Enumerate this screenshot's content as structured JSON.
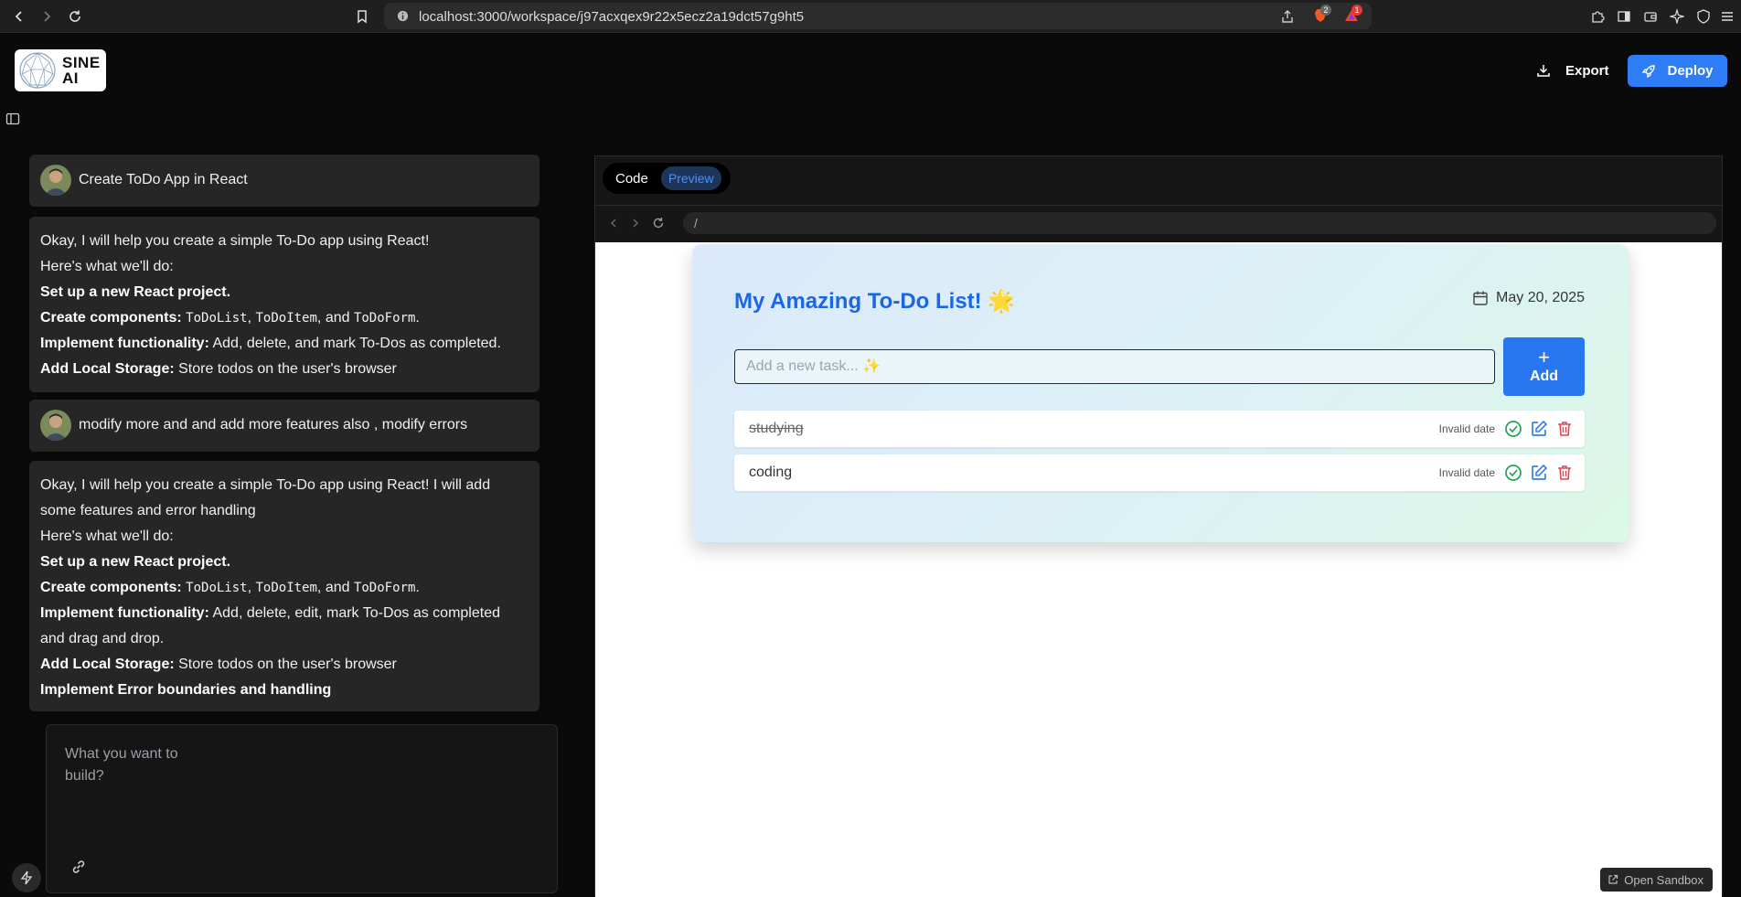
{
  "browser": {
    "url": "localhost:3000/workspace/j97acxqex9r22x5ecz2a19dct57g9ht5",
    "brave_badge": "2",
    "alert_badge": "1"
  },
  "header": {
    "logo_text": "SINE\nAI",
    "export_label": "Export",
    "deploy_label": "Deploy"
  },
  "chat": {
    "user_msg_1": "Create ToDo App in React",
    "ai_msg_1": {
      "line1": "Okay, I will help you create a simple To-Do app using React!",
      "line2": "Here's what we'll do:",
      "step1": "Set up a new React project.",
      "step2_label": "Create components:",
      "comp1": "ToDoList",
      "comp2": "ToDoItem",
      "comp3": "ToDoForm",
      "sep1": ", ",
      "sep2": ", and ",
      "end": ".",
      "step3_label": "Implement functionality:",
      "step3_text": " Add, delete, and mark To-Dos as completed.",
      "step4_label": "Add Local Storage:",
      "step4_text": " Store todos on the user's browser"
    },
    "user_msg_2": "modify more and and add more features also , modify errors",
    "ai_msg_2": {
      "line1": "Okay, I will help you create a simple To-Do app using React! I will add some features and error handling",
      "line2": "Here's what we'll do:",
      "step1": "Set up a new React project.",
      "step2_label": "Create components:",
      "comp1": "ToDoList",
      "comp2": "ToDoItem",
      "comp3": "ToDoForm",
      "sep1": ", ",
      "sep2": ", and ",
      "end": ".",
      "step3_label": "Implement functionality:",
      "step3_text": " Add, delete, edit, mark To-Dos as completed and drag and drop.",
      "step4_label": "Add Local Storage:",
      "step4_text": " Store todos on the user's browser",
      "step5": "Implement Error boundaries and handling"
    },
    "prompt_placeholder": "What you want to build?"
  },
  "preview": {
    "tab_code": "Code",
    "tab_preview": "Preview",
    "path": "/",
    "open_sandbox": "Open Sandbox",
    "todo": {
      "title": "My Amazing To-Do List! 🌟",
      "date": "May 20, 2025",
      "input_placeholder": "Add a new task... ✨",
      "add_plus": "+",
      "add_label": "Add",
      "tasks": [
        {
          "text": "studying",
          "date": "Invalid date",
          "completed": true
        },
        {
          "text": "coding",
          "date": "Invalid date",
          "completed": false
        }
      ]
    }
  },
  "colors": {
    "accent": "#2e7cf6",
    "title_blue": "#1a66e6",
    "complete_green": "#22a552",
    "edit_blue": "#2f80ed",
    "delete_red": "#e5484d"
  }
}
